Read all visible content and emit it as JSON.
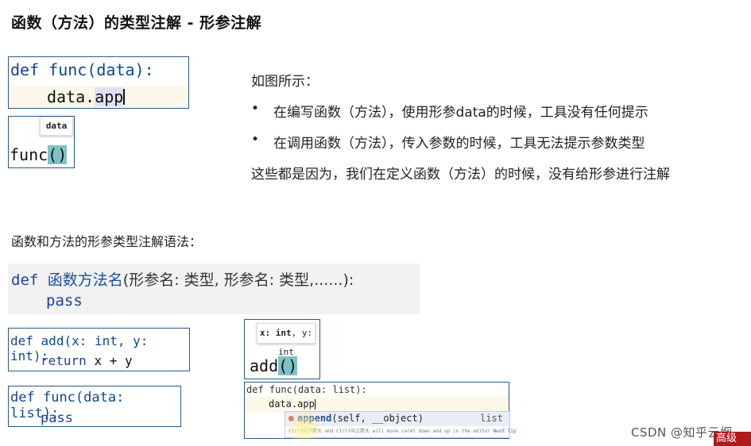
{
  "title": "函数（方法）的类型注解 - 形参注解",
  "example1": {
    "def_kw": "def",
    "func_sig": "func(data):",
    "line2_pre": "data.",
    "line2_sel": "app",
    "tooltip": "data",
    "call_name": "func",
    "call_parens": "()"
  },
  "description": {
    "intro": "如图所示：",
    "bullet_char": "•",
    "bullets": [
      "在编写函数（方法），使用形参data的时候，工具没有任何提示",
      "在调用函数（方法），传入参数的时候，工具无法提示参数类型"
    ],
    "conclusion": "这些都是因为，我们在定义函数（方法）的时候，没有给形参进行注解"
  },
  "syntax_heading": "函数和方法的形参类型注解语法：",
  "syntax": {
    "def_kw": "def",
    "name": "函数方法名",
    "params": "(形参名: 类型, 形参名: 类型,......):",
    "body": "pass"
  },
  "example_add": {
    "def_kw": "def",
    "sig": "add(x: int, y: int):",
    "ret_kw": "return",
    "ret_expr": "x + y"
  },
  "example_func": {
    "def_kw": "def",
    "sig": "func(data: list):",
    "body": "pass"
  },
  "add_call": {
    "tooltip_bold": "x: int",
    "tooltip_rest": ", y: int",
    "call_name": "add",
    "call_parens": "()"
  },
  "completion": {
    "line1": "def func(data: list):",
    "line2": "data.app",
    "item_bold": "append",
    "item_args": "(self, __object)",
    "item_type": "list",
    "hint": "Ctrl+向下箭头 and Ctrl+向上箭头 will move caret down and up in the editor",
    "next_tip": "Next Tip",
    "more": "⋮"
  },
  "watermark": "CSDN @知乎云烟",
  "banner": "高级"
}
